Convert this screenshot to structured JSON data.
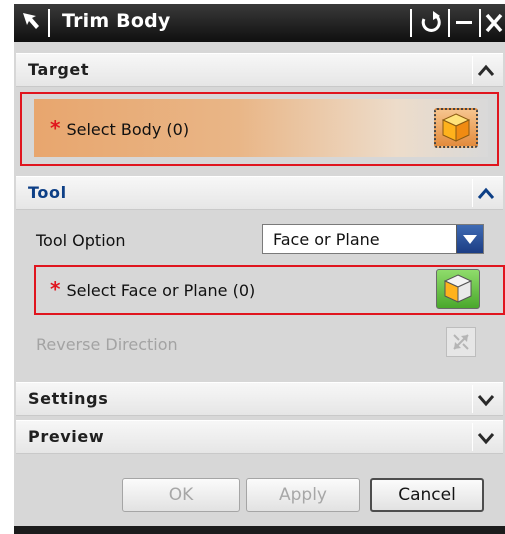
{
  "titlebar": {
    "title": "Trim Body",
    "icons": [
      "pin-arrow-icon",
      "reset-icon",
      "minimize-icon",
      "close-icon"
    ]
  },
  "target": {
    "label": "Target",
    "select_label": "Select Body (0)",
    "required_marker": "*"
  },
  "tool": {
    "label": "Tool",
    "option_label": "Tool Option",
    "option_value": "Face or Plane",
    "select_label": "Select Face or Plane (0)",
    "required_marker": "*",
    "reverse_label": "Reverse Direction"
  },
  "settings": {
    "label": "Settings"
  },
  "preview": {
    "label": "Preview"
  },
  "footer": {
    "ok": "OK",
    "apply": "Apply",
    "cancel": "Cancel"
  },
  "colors": {
    "title_bg": "#0f0f0f",
    "active_section": "#0d3f86",
    "required_star": "#e0151e",
    "highlight_box": "#e0151e",
    "body_select_gradient_start": "#e8a66e",
    "face_button_bg": "#6ec24a"
  }
}
